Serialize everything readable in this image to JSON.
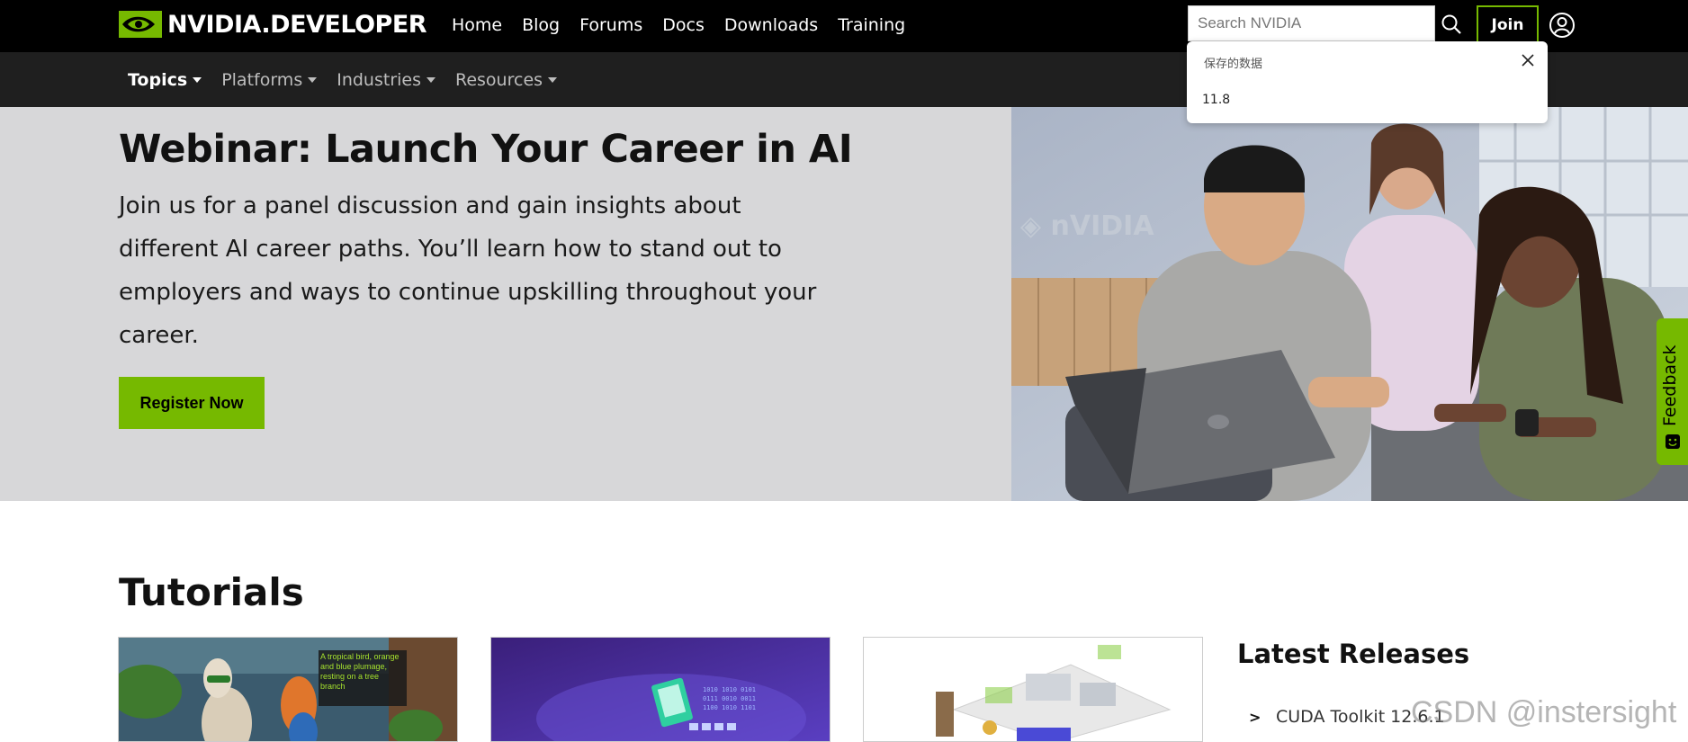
{
  "header": {
    "logo_text": "NVIDIA.DEVELOPER",
    "nav": [
      "Home",
      "Blog",
      "Forums",
      "Docs",
      "Downloads",
      "Training"
    ],
    "search_placeholder": "Search NVIDIA",
    "join_label": "Join"
  },
  "subnav": {
    "items": [
      "Topics",
      "Platforms",
      "Industries",
      "Resources"
    ]
  },
  "dropdown": {
    "title": "保存的数据",
    "item": "11.8"
  },
  "hero": {
    "title": "Webinar: Launch Your Career in AI",
    "text": "Join us for a panel discussion and gain insights about different AI career paths. You’ll learn how to stand out to employers and ways to continue upskilling throughout your career.",
    "cta": "Register Now"
  },
  "feedback": {
    "label": "Feedback"
  },
  "tutorials": {
    "title": "Tutorials",
    "card1_caption": "A tropical bird, orange and blue plumage, resting on a tree branch"
  },
  "latest": {
    "title": "Latest Releases",
    "arrow": ">",
    "item": "CUDA Toolkit 12.6.1"
  },
  "watermark": "CSDN @instersight",
  "colors": {
    "brand_green": "#76b900",
    "topbar": "#000000",
    "subnav": "#1f1f1f",
    "hero_bg": "#d7d7d9"
  }
}
